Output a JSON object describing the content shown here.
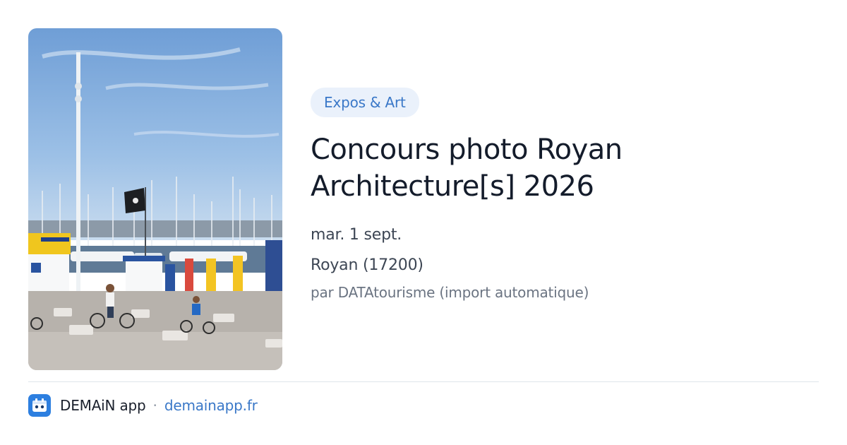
{
  "card": {
    "category": "Expos & Art",
    "title_line1": "Concours photo Royan",
    "title_line2": "Architecture[s] 2026",
    "date": "mar. 1 sept.",
    "location": "Royan (17200)",
    "author": "par DATAtourisme (import automatique)"
  },
  "footer": {
    "app_name": "DEMAiN app",
    "separator": "·",
    "link": "demainapp.fr"
  },
  "icons": {
    "app_logo": "demain-app-logo-icon"
  },
  "colors": {
    "accent": "#3a78c8",
    "badge_bg": "#eaf1fb",
    "divider": "#dfe5ea",
    "logo_bg": "#2d7fe0"
  }
}
